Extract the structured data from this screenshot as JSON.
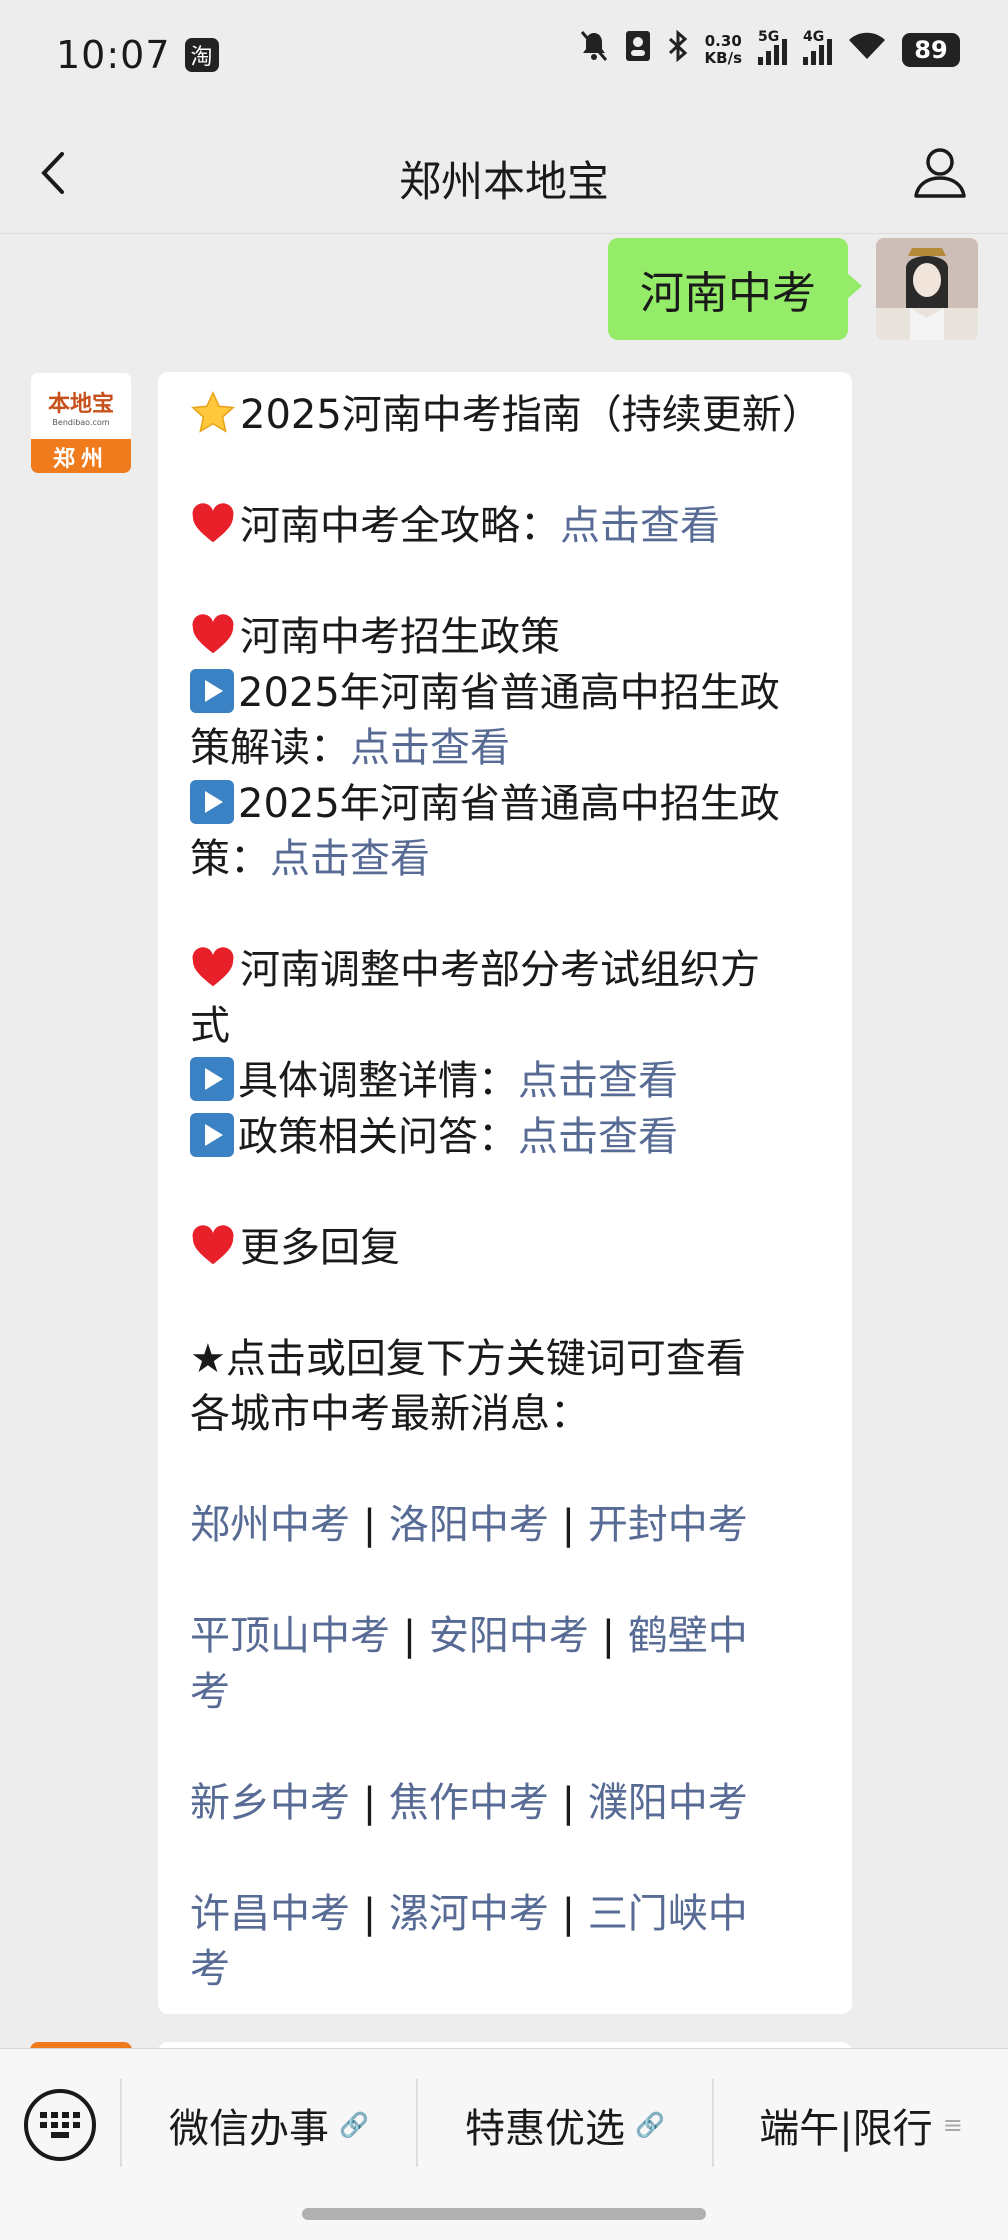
{
  "status_bar": {
    "time": "10:07",
    "app_icon": "淘",
    "net_speed_value": "0.30",
    "net_speed_unit": "KB/s",
    "network_5g": "5G",
    "network_4g": "4G",
    "battery": "89"
  },
  "nav": {
    "title": "郑州本地宝"
  },
  "user_message": "河南中考",
  "bot_avatar": {
    "brand": "本地宝",
    "url": "Bendibao.com",
    "city": "郑州"
  },
  "message": {
    "headline": "2025河南中考指南（持续更新）",
    "strategy_label": "河南中考全攻略：",
    "view_link": "点击查看",
    "policy_heading": "河南中考招生政策",
    "policy_item1_line1": "2025年河南省普通高中招生政",
    "policy_item1_line2": "策解读：",
    "policy_item2_line1": "2025年河南省普通高中招生政",
    "policy_item2_line2": "策：",
    "adjust_heading_line1": "河南调整中考部分考试组织方",
    "adjust_heading_line2": "式",
    "adjust_detail_label": "具体调整详情：",
    "adjust_qa_label": "政策相关问答：",
    "more_heading": "更多回复",
    "keyword_intro_line1": "★点击或回复下方关键词可查看",
    "keyword_intro_line2": "各城市中考最新消息：",
    "sep": " | ",
    "cities": [
      "郑州中考",
      "洛阳中考",
      "开封中考",
      "平顶山中考",
      "安阳中考",
      "鹤壁中",
      "考",
      "新乡中考",
      "焦作中考",
      "濮阳中考",
      "许昌中考",
      "漯河中考",
      "三门峡中",
      "考"
    ]
  },
  "bottom_menu": {
    "items": [
      "微信办事",
      "特惠优选",
      "端午|限行"
    ]
  },
  "colors": {
    "user_bubble": "#95ec69",
    "link": "#576b95",
    "background": "#ededed"
  }
}
